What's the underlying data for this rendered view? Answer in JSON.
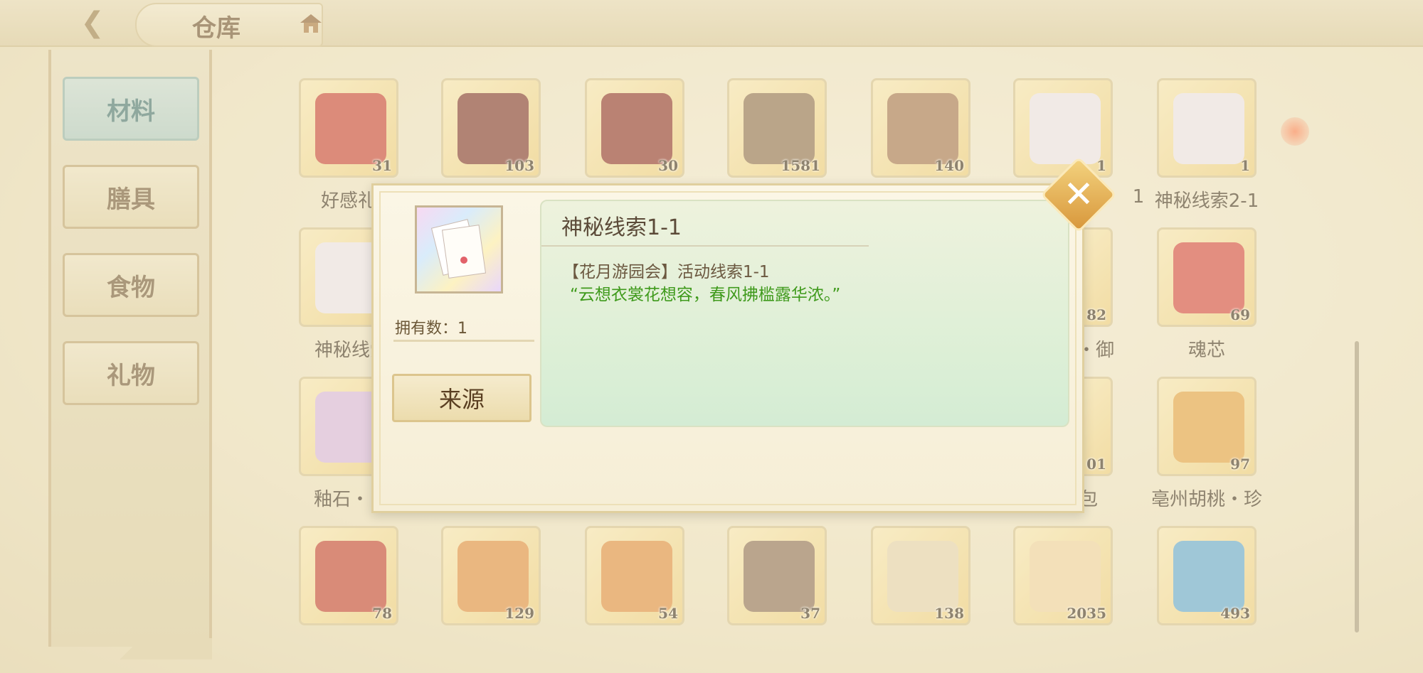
{
  "header": {
    "title": "仓库",
    "back_icon": "back-arrow-icon",
    "home_icon": "house-icon"
  },
  "sidebar": {
    "tabs": [
      {
        "label": "材料",
        "active": true
      },
      {
        "label": "膳具",
        "active": false
      },
      {
        "label": "食物",
        "active": false
      },
      {
        "label": "礼物",
        "active": false
      }
    ]
  },
  "grid": {
    "row1": [
      {
        "count": "31",
        "name": "好感礼",
        "color": "#c83b2e"
      },
      {
        "count": "103",
        "name": "",
        "color": "#7a2c24"
      },
      {
        "count": "30",
        "name": "",
        "color": "#8a2a22"
      },
      {
        "count": "1581",
        "name": "",
        "color": "#8a6a4a"
      },
      {
        "count": "140",
        "name": "",
        "color": "#a2704a"
      },
      {
        "count": "1",
        "name": "1",
        "color": "#efe7f3"
      },
      {
        "count": "1",
        "name": "神秘线索2-1",
        "color": "#efe7f3"
      }
    ],
    "row2": [
      {
        "count": "",
        "name": "神秘线索",
        "color": "#efe7f3"
      },
      {
        "count": "82",
        "name": "・御",
        "color": "#6ea24a"
      },
      {
        "count": "69",
        "name": "魂芯",
        "color": "#d6413a"
      }
    ],
    "row3": [
      {
        "count": "",
        "name": "釉石・",
        "color": "#d9b7e6"
      },
      {
        "count": "01",
        "name": "包",
        "color": "#b8a5e0"
      },
      {
        "count": "97",
        "name": "亳州胡桃・珍",
        "color": "#e5a03c"
      }
    ],
    "row4": [
      {
        "count": "78",
        "color": "#c43b2a"
      },
      {
        "count": "129",
        "color": "#e28a3a"
      },
      {
        "count": "54",
        "color": "#e28a3a"
      },
      {
        "count": "37",
        "color": "#8a6a50"
      },
      {
        "count": "138",
        "color": "#e8d6b0"
      },
      {
        "count": "2035",
        "color": "#f2d6a0"
      },
      {
        "count": "493",
        "color": "#5aa8d8"
      }
    ]
  },
  "modal": {
    "owned_label": "拥有数：1",
    "source_button": "来源",
    "item_title": "神秘线索1-1",
    "desc_line1": "【花月游园会】活动线索1-1",
    "desc_line2": "“云想衣裳花想容，春风拂槛露华浓。”",
    "close_icon": "close-x-icon",
    "desc_text_color": "#3f9a1c"
  }
}
